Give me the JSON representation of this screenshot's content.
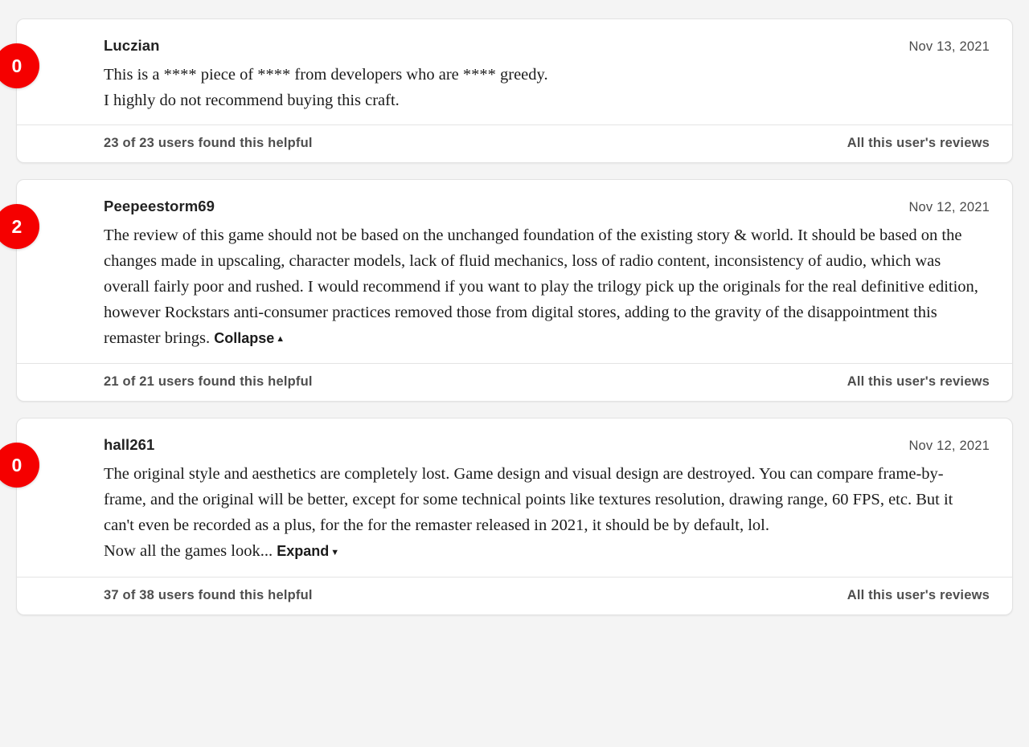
{
  "theme": {
    "page_background": "#f4f4f4",
    "card_background": "#ffffff",
    "badge_red": "#f50000",
    "text_primary": "#1b1b1b",
    "text_muted": "#4e4e4e",
    "border": "#e2e2e2"
  },
  "reviews": [
    {
      "score": "0",
      "username": "Luczian",
      "date": "Nov 13, 2021",
      "body": "This is a **** piece of **** from developers who are **** greedy.\nI highly do not recommend buying this craft.",
      "toggle_label": "",
      "toggle_caret": "",
      "helpful": "23 of 23 users found this helpful",
      "all_reviews_label": "All this user's reviews"
    },
    {
      "score": "2",
      "username": "Peepeestorm69",
      "date": "Nov 12, 2021",
      "body": "The review of this game should not be based on the unchanged foundation of the existing story & world. It should be based on the changes made in upscaling, character models, lack of fluid mechanics, loss of radio content, inconsistency of audio, which was overall fairly poor and rushed. I would recommend if you want to play the trilogy pick up the originals for the real definitive edition, however Rockstars anti-consumer practices removed those from digital stores, adding to the gravity of the disappointment this remaster brings.",
      "toggle_label": "Collapse",
      "toggle_caret": "▲",
      "helpful": "21 of 21 users found this helpful",
      "all_reviews_label": "All this user's reviews"
    },
    {
      "score": "0",
      "username": "hall261",
      "date": "Nov 12, 2021",
      "body": "The original style and aesthetics are completely lost. Game design and visual design are destroyed. You can compare frame-by-frame, and the original will be better, except for some technical points like textures resolution, drawing range, 60 FPS, etc. But it can't even be recorded as a plus, for the for the remaster released in 2021, it should be by default, lol.\nNow all the games look...",
      "toggle_label": "Expand",
      "toggle_caret": "▼",
      "helpful": "37 of 38 users found this helpful",
      "all_reviews_label": "All this user's reviews"
    }
  ]
}
